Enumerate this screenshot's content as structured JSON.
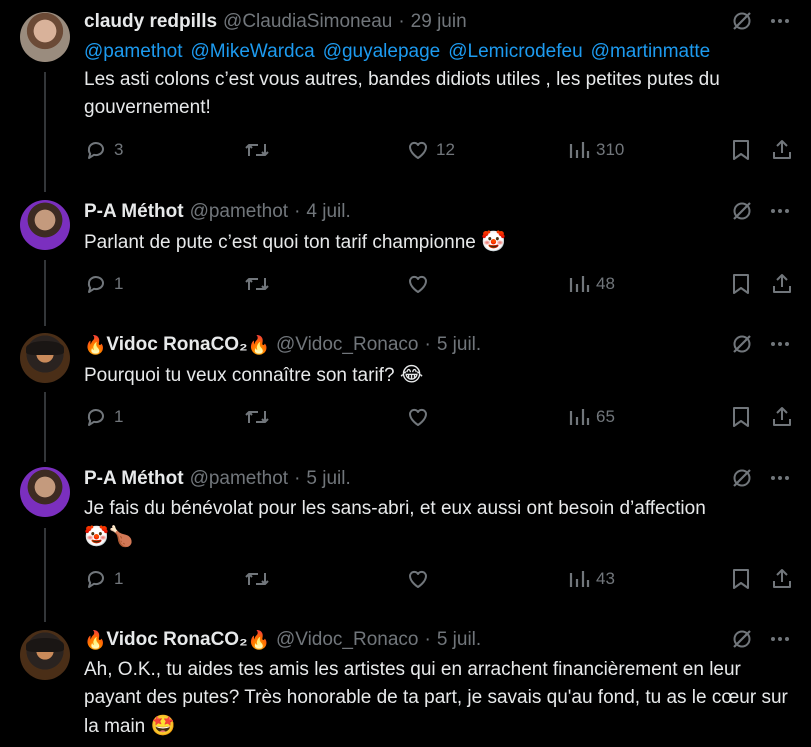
{
  "tweets": [
    {
      "name": "claudy redpills",
      "handle": "@ClaudiaSimoneau",
      "dot": "·",
      "date": "29 juin",
      "mentions": [
        "@pamethot",
        "@MikeWardca",
        "@guyalepage",
        "@Lemicrodefeu",
        "@martinmatte"
      ],
      "text": "Les asti colons c’est vous autres, bandes didiots utiles , les petites putes du gouvernement!",
      "replies": "3",
      "retweets": "",
      "likes": "12",
      "views": "310"
    },
    {
      "name": "P-A Méthot",
      "handle": "@pamethot",
      "dot": "·",
      "date": "4 juil.",
      "text": "Parlant de pute c’est quoi ton tarif championne",
      "emoji": "🤡",
      "replies": "1",
      "retweets": "",
      "likes": "",
      "views": "48"
    },
    {
      "name_prefix": "🔥",
      "name": "Vidoc RonaCO₂",
      "name_suffix": "🔥",
      "handle": "@Vidoc_Ronaco",
      "dot": "·",
      "date": "5 juil.",
      "text": "Pourquoi tu veux connaître son tarif?",
      "emoji": "😂",
      "replies": "1",
      "retweets": "",
      "likes": "",
      "views": "65"
    },
    {
      "name": "P-A Méthot",
      "handle": "@pamethot",
      "dot": "·",
      "date": "5 juil.",
      "text": "Je fais du bénévolat pour les sans-abri, et eux aussi ont besoin d’affection",
      "emoji": "🤡🍗",
      "replies": "1",
      "retweets": "",
      "likes": "",
      "views": "43"
    },
    {
      "name_prefix": "🔥",
      "name": "Vidoc RonaCO₂",
      "name_suffix": "🔥",
      "handle": "@Vidoc_Ronaco",
      "dot": "·",
      "date": "5 juil.",
      "text": "Ah, O.K., tu aides tes amis les artistes qui en arrachent financièrement en leur payant des putes? Très honorable de ta part, je savais qu'au fond, tu as le cœur sur la main",
      "emoji": "🤩"
    }
  ],
  "icons": {
    "grok": "grok-icon",
    "more": "more-icon",
    "reply": "reply-icon",
    "retweet": "retweet-icon",
    "like": "like-icon",
    "views": "views-icon",
    "bookmark": "bookmark-icon",
    "share": "share-icon"
  },
  "colors": {
    "background": "#000000",
    "text": "#e7e9ea",
    "secondary": "#71767b",
    "link": "#1d9bf0",
    "thread_line": "#333639"
  }
}
